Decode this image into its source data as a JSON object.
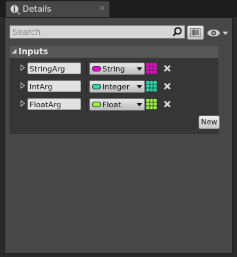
{
  "tab": {
    "title": "Details",
    "close_glyph": "×",
    "icon": "info-icon"
  },
  "search": {
    "placeholder": "Search",
    "value": ""
  },
  "toolbar": {
    "list_view_icon": "list-view-icon",
    "view_options_icon": "eye-icon"
  },
  "inputs": {
    "label": "Inputs",
    "rows": [
      {
        "name": "StringArg",
        "type": "String",
        "pin_color": "#ff00d4",
        "grid_color": "#ff00d4"
      },
      {
        "name": "IntArg",
        "type": "Integer",
        "pin_color": "#1fe3af",
        "grid_color": "#1fe3af"
      },
      {
        "name": "FloatArg",
        "type": "Float",
        "pin_color": "#9cfc3b",
        "grid_color": "#9cfc3b"
      }
    ],
    "new_label": "New"
  }
}
